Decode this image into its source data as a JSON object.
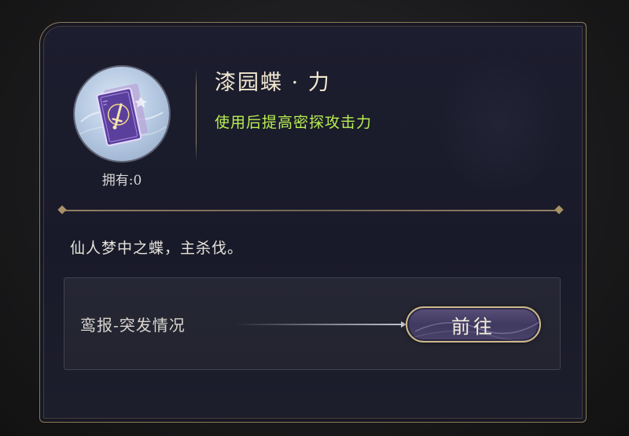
{
  "item": {
    "title": "漆园蝶 · 力",
    "effect": "使用后提高密探攻击力",
    "owned": "拥有:0",
    "flavor": "仙人梦中之蝶，主杀伐。",
    "icon": "sword-card-icon"
  },
  "source": {
    "label": "鸾报-突发情况",
    "go_button": "前往"
  },
  "colors": {
    "title": "#f1e8cf",
    "effect": "#b8ee52",
    "frame": "#8b7a5a",
    "button_fill": "#4a4268",
    "button_border": "#cdb98a"
  }
}
